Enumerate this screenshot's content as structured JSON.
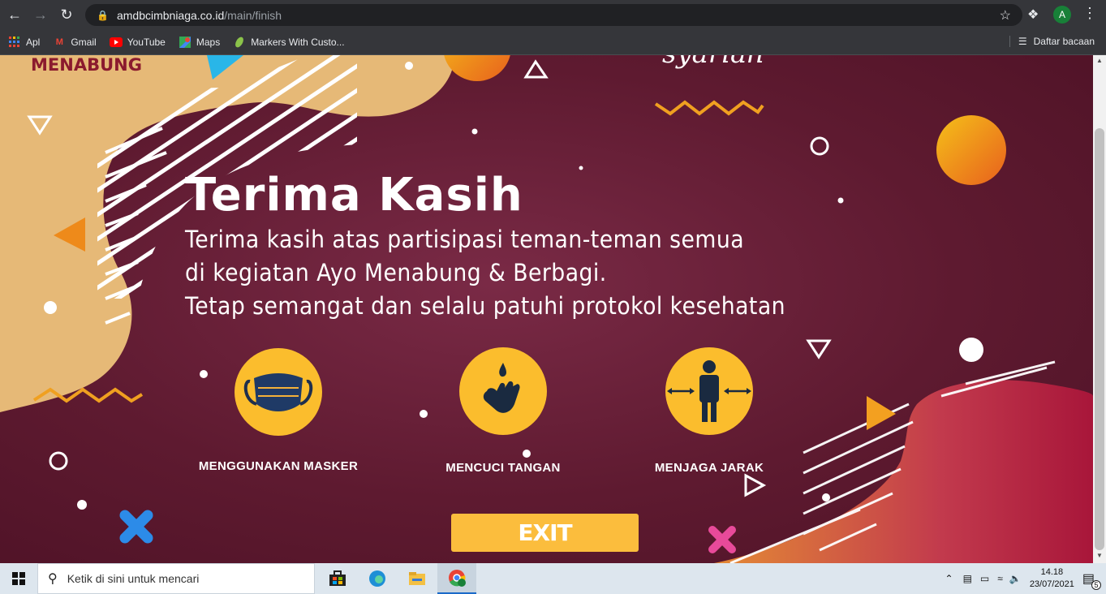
{
  "browser": {
    "url_host": "amdbcimbniaga.co.id",
    "url_path": "/main/finish",
    "profile_initial": "A",
    "bookmarks": [
      {
        "label": "Apl",
        "icon": "apps-grid-icon"
      },
      {
        "label": "Gmail",
        "icon": "gmail-icon"
      },
      {
        "label": "YouTube",
        "icon": "youtube-icon"
      },
      {
        "label": "Maps",
        "icon": "maps-icon"
      },
      {
        "label": "Markers With Custo...",
        "icon": "leaf-icon"
      }
    ],
    "reading_list": "Daftar bacaan"
  },
  "page": {
    "logo": "MENABUNG",
    "script_text": "syariah",
    "title": "Terima Kasih",
    "lines": [
      "Terima kasih atas partisipasi teman-teman semua",
      "di kegiatan Ayo Menabung & Berbagi.",
      "Tetap semangat dan selalu patuhi protokol kesehatan"
    ],
    "protocols": [
      {
        "label": "MENGGUNAKAN MASKER",
        "icon": "face-mask-icon"
      },
      {
        "label": "MENCUCI TANGAN",
        "icon": "hand-wash-icon"
      },
      {
        "label": "MENJAGA JARAK",
        "icon": "social-distance-icon"
      }
    ],
    "exit_label": "EXIT",
    "colors": {
      "background": "#6a2039",
      "accent": "#fbbd2d",
      "sand": "#e8b96a"
    }
  },
  "taskbar": {
    "search_placeholder": "Ketik di sini untuk mencari",
    "time": "14.18",
    "date": "23/07/2021",
    "notification_count": "5"
  }
}
